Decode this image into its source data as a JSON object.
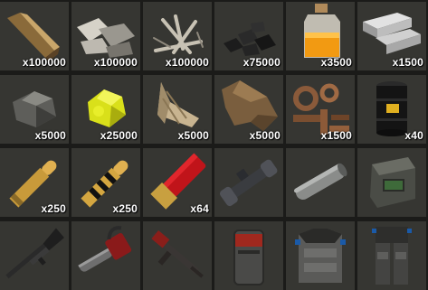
{
  "inventory": {
    "slots": [
      {
        "icon": "wood-icon",
        "quantity": "x100000"
      },
      {
        "icon": "stones-icon",
        "quantity": "x100000"
      },
      {
        "icon": "bones-icon",
        "quantity": "x100000"
      },
      {
        "icon": "charcoal-icon",
        "quantity": "x75000"
      },
      {
        "icon": "low-grade-fuel-jar-icon",
        "quantity": "x3500"
      },
      {
        "icon": "metal-ingots-icon",
        "quantity": "x1500"
      },
      {
        "icon": "metal-ore-icon",
        "quantity": "x5000"
      },
      {
        "icon": "sulfur-ore-icon",
        "quantity": "x25000"
      },
      {
        "icon": "cloth-icon",
        "quantity": "x5000"
      },
      {
        "icon": "leather-icon",
        "quantity": "x5000"
      },
      {
        "icon": "metal-fragments-icon",
        "quantity": "x1500"
      },
      {
        "icon": "fuel-barrel-icon",
        "quantity": "x40"
      },
      {
        "icon": "rifle-ammo-icon",
        "quantity": "x250"
      },
      {
        "icon": "incendiary-ammo-icon",
        "quantity": "x250"
      },
      {
        "icon": "shotgun-shell-icon",
        "quantity": "x64"
      },
      {
        "icon": "scope-icon",
        "quantity": ""
      },
      {
        "icon": "metal-pipe-icon",
        "quantity": ""
      },
      {
        "icon": "tech-trash-icon",
        "quantity": ""
      },
      {
        "icon": "shotgun-icon",
        "quantity": ""
      },
      {
        "icon": "chainsaw-icon",
        "quantity": ""
      },
      {
        "icon": "assault-rifle-icon",
        "quantity": ""
      },
      {
        "icon": "metal-facemask-icon",
        "quantity": ""
      },
      {
        "icon": "metal-chestplate-icon",
        "quantity": ""
      },
      {
        "icon": "roadsign-kilt-icon",
        "quantity": ""
      }
    ]
  }
}
